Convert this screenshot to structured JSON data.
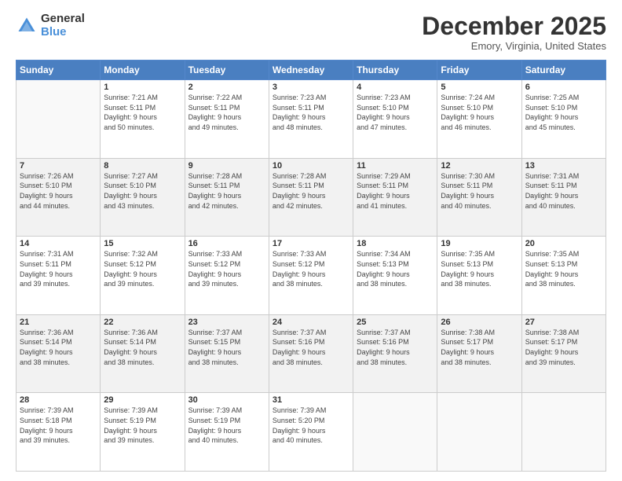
{
  "logo": {
    "general": "General",
    "blue": "Blue"
  },
  "header": {
    "month": "December 2025",
    "location": "Emory, Virginia, United States"
  },
  "weekdays": [
    "Sunday",
    "Monday",
    "Tuesday",
    "Wednesday",
    "Thursday",
    "Friday",
    "Saturday"
  ],
  "weeks": [
    [
      {
        "day": "",
        "info": ""
      },
      {
        "day": "1",
        "info": "Sunrise: 7:21 AM\nSunset: 5:11 PM\nDaylight: 9 hours\nand 50 minutes."
      },
      {
        "day": "2",
        "info": "Sunrise: 7:22 AM\nSunset: 5:11 PM\nDaylight: 9 hours\nand 49 minutes."
      },
      {
        "day": "3",
        "info": "Sunrise: 7:23 AM\nSunset: 5:11 PM\nDaylight: 9 hours\nand 48 minutes."
      },
      {
        "day": "4",
        "info": "Sunrise: 7:23 AM\nSunset: 5:10 PM\nDaylight: 9 hours\nand 47 minutes."
      },
      {
        "day": "5",
        "info": "Sunrise: 7:24 AM\nSunset: 5:10 PM\nDaylight: 9 hours\nand 46 minutes."
      },
      {
        "day": "6",
        "info": "Sunrise: 7:25 AM\nSunset: 5:10 PM\nDaylight: 9 hours\nand 45 minutes."
      }
    ],
    [
      {
        "day": "7",
        "info": "Sunrise: 7:26 AM\nSunset: 5:10 PM\nDaylight: 9 hours\nand 44 minutes."
      },
      {
        "day": "8",
        "info": "Sunrise: 7:27 AM\nSunset: 5:10 PM\nDaylight: 9 hours\nand 43 minutes."
      },
      {
        "day": "9",
        "info": "Sunrise: 7:28 AM\nSunset: 5:11 PM\nDaylight: 9 hours\nand 42 minutes."
      },
      {
        "day": "10",
        "info": "Sunrise: 7:28 AM\nSunset: 5:11 PM\nDaylight: 9 hours\nand 42 minutes."
      },
      {
        "day": "11",
        "info": "Sunrise: 7:29 AM\nSunset: 5:11 PM\nDaylight: 9 hours\nand 41 minutes."
      },
      {
        "day": "12",
        "info": "Sunrise: 7:30 AM\nSunset: 5:11 PM\nDaylight: 9 hours\nand 40 minutes."
      },
      {
        "day": "13",
        "info": "Sunrise: 7:31 AM\nSunset: 5:11 PM\nDaylight: 9 hours\nand 40 minutes."
      }
    ],
    [
      {
        "day": "14",
        "info": "Sunrise: 7:31 AM\nSunset: 5:11 PM\nDaylight: 9 hours\nand 39 minutes."
      },
      {
        "day": "15",
        "info": "Sunrise: 7:32 AM\nSunset: 5:12 PM\nDaylight: 9 hours\nand 39 minutes."
      },
      {
        "day": "16",
        "info": "Sunrise: 7:33 AM\nSunset: 5:12 PM\nDaylight: 9 hours\nand 39 minutes."
      },
      {
        "day": "17",
        "info": "Sunrise: 7:33 AM\nSunset: 5:12 PM\nDaylight: 9 hours\nand 38 minutes."
      },
      {
        "day": "18",
        "info": "Sunrise: 7:34 AM\nSunset: 5:13 PM\nDaylight: 9 hours\nand 38 minutes."
      },
      {
        "day": "19",
        "info": "Sunrise: 7:35 AM\nSunset: 5:13 PM\nDaylight: 9 hours\nand 38 minutes."
      },
      {
        "day": "20",
        "info": "Sunrise: 7:35 AM\nSunset: 5:13 PM\nDaylight: 9 hours\nand 38 minutes."
      }
    ],
    [
      {
        "day": "21",
        "info": "Sunrise: 7:36 AM\nSunset: 5:14 PM\nDaylight: 9 hours\nand 38 minutes."
      },
      {
        "day": "22",
        "info": "Sunrise: 7:36 AM\nSunset: 5:14 PM\nDaylight: 9 hours\nand 38 minutes."
      },
      {
        "day": "23",
        "info": "Sunrise: 7:37 AM\nSunset: 5:15 PM\nDaylight: 9 hours\nand 38 minutes."
      },
      {
        "day": "24",
        "info": "Sunrise: 7:37 AM\nSunset: 5:16 PM\nDaylight: 9 hours\nand 38 minutes."
      },
      {
        "day": "25",
        "info": "Sunrise: 7:37 AM\nSunset: 5:16 PM\nDaylight: 9 hours\nand 38 minutes."
      },
      {
        "day": "26",
        "info": "Sunrise: 7:38 AM\nSunset: 5:17 PM\nDaylight: 9 hours\nand 38 minutes."
      },
      {
        "day": "27",
        "info": "Sunrise: 7:38 AM\nSunset: 5:17 PM\nDaylight: 9 hours\nand 39 minutes."
      }
    ],
    [
      {
        "day": "28",
        "info": "Sunrise: 7:39 AM\nSunset: 5:18 PM\nDaylight: 9 hours\nand 39 minutes."
      },
      {
        "day": "29",
        "info": "Sunrise: 7:39 AM\nSunset: 5:19 PM\nDaylight: 9 hours\nand 39 minutes."
      },
      {
        "day": "30",
        "info": "Sunrise: 7:39 AM\nSunset: 5:19 PM\nDaylight: 9 hours\nand 40 minutes."
      },
      {
        "day": "31",
        "info": "Sunrise: 7:39 AM\nSunset: 5:20 PM\nDaylight: 9 hours\nand 40 minutes."
      },
      {
        "day": "",
        "info": ""
      },
      {
        "day": "",
        "info": ""
      },
      {
        "day": "",
        "info": ""
      }
    ]
  ]
}
